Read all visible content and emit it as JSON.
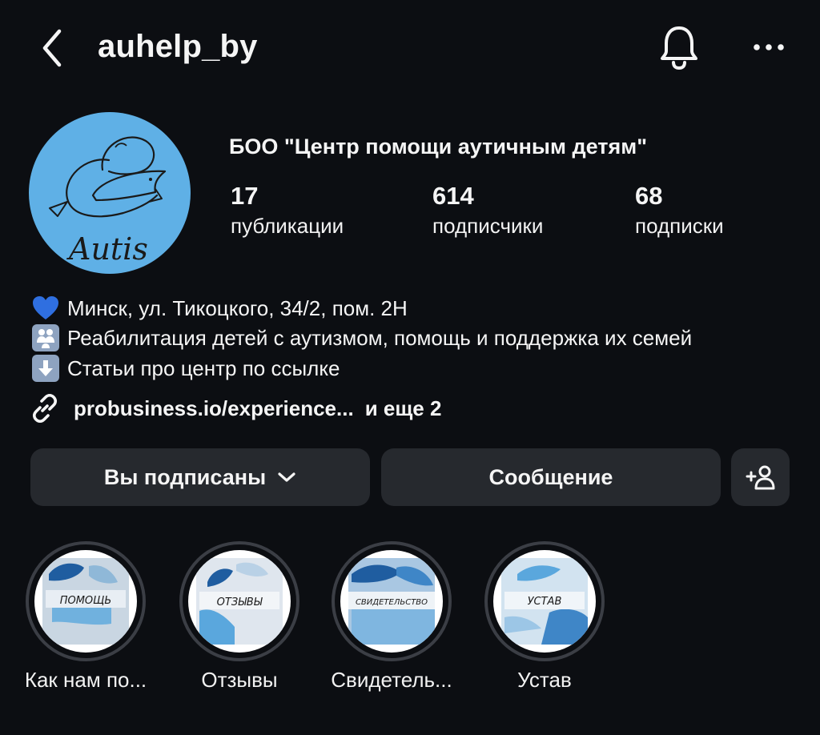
{
  "header": {
    "username": "auhelp_by",
    "back_icon": "chevron-left-icon",
    "bell_icon": "bell-icon",
    "more_icon": "more-horizontal-icon"
  },
  "profile": {
    "name": "БОО \"Центр помощи аутичным детям\"",
    "avatar_text": "Autis",
    "avatar_color": "#5fb0e6",
    "stats": [
      {
        "value": "17",
        "label": "публикации"
      },
      {
        "value": "614",
        "label": "подписчики"
      },
      {
        "value": "68",
        "label": "подписки"
      }
    ]
  },
  "bio": {
    "lines": [
      {
        "icon": "blue-heart-icon",
        "text": "Минск, ул. Тикоцкого, 34/2, пом. 2Н"
      },
      {
        "icon": "family-icon",
        "text": "Реабилитация детей с аутизмом, помощь и поддержка их семей"
      },
      {
        "icon": "down-arrow-icon",
        "text": "Статьи про центр по ссылке"
      }
    ],
    "link": "probusiness.io/experience...",
    "link_more": "и еще 2"
  },
  "actions": {
    "follow_label": "Вы подписаны",
    "message_label": "Сообщение",
    "add_user_icon": "add-user-icon"
  },
  "highlights": [
    {
      "label": "Как нам по...",
      "cover": "ПОМОЩЬ"
    },
    {
      "label": "Отзывы",
      "cover": "ОТЗЫВЫ"
    },
    {
      "label": "Свидетель...",
      "cover": "СВИДЕТЕЛЬСТВО"
    },
    {
      "label": "Устав",
      "cover": "УСТАВ"
    }
  ],
  "colors": {
    "background": "#0c0e12",
    "button": "#26292e",
    "text": "#f5f5f5"
  }
}
